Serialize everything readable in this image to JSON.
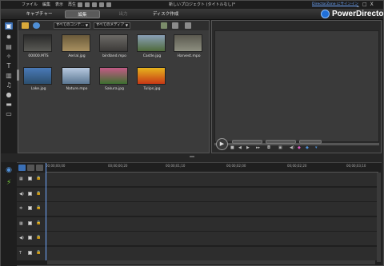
{
  "titlebar": {
    "menu": [
      "ファイル",
      "編集",
      "表示",
      "再生"
    ],
    "title": "新しいプロジェクト (タイトルなし)*",
    "signin": "DirectorZone にサインイン",
    "window_controls": [
      "_",
      "□",
      "X"
    ]
  },
  "modes": {
    "capture": "キャプチャー",
    "edit": "編集",
    "produce": "出力",
    "disc": "ディスク作成"
  },
  "brand": {
    "name": "PowerDirector",
    "logo_color": "#1f6fd8"
  },
  "library": {
    "filter_content": "すべてのコンテ...",
    "filter_media": "すべてのメディア",
    "items": [
      {
        "label": "00000.MTS",
        "icon": "video-thumb",
        "color_top": "#2a2a2a",
        "color_bottom": "#5a5a55"
      },
      {
        "label": "Aerial.jpg",
        "icon": "image-thumb",
        "color_top": "#6a5a3a",
        "color_bottom": "#a89060"
      },
      {
        "label": "birdland.mpo",
        "icon": "image-thumb",
        "color_top": "#6c6a66",
        "color_bottom": "#3c3a38"
      },
      {
        "label": "Castle.jpg",
        "icon": "image-thumb",
        "color_top": "#8aa0b8",
        "color_bottom": "#4f6a3a"
      },
      {
        "label": "Harvest.mpo",
        "icon": "image-thumb",
        "color_top": "#5c5a50",
        "color_bottom": "#8d8f80"
      },
      {
        "label": "Lake.jpg",
        "icon": "image-thumb",
        "color_top": "#4a7ab8",
        "color_bottom": "#2c4f6e"
      },
      {
        "label": "Nature.mpo",
        "icon": "image-thumb",
        "color_top": "#b7c8df",
        "color_bottom": "#5b7792"
      },
      {
        "label": "Sakura.jpg",
        "icon": "image-thumb",
        "color_top": "#c25a86",
        "color_bottom": "#3d6f2f"
      },
      {
        "label": "Tulips.jpg",
        "icon": "image-thumb",
        "color_top": "#e6b41d",
        "color_bottom": "#c83816"
      }
    ]
  },
  "timeline": {
    "ruler_ticks": [
      "00;00;00;00",
      "00;00;00;20",
      "00;00;01;10",
      "00;00;02;00",
      "00;00;02;20",
      "00;00;03;10"
    ],
    "tracks": [
      {
        "icon": "video-track-icon",
        "glyph": "▦"
      },
      {
        "icon": "audio-track-icon",
        "glyph": "◀)"
      },
      {
        "icon": "effect-track-icon",
        "glyph": "✲"
      },
      {
        "icon": "overlay-track-icon",
        "glyph": "▦"
      },
      {
        "icon": "voice-track-icon",
        "glyph": "◀)"
      },
      {
        "icon": "title-track-icon",
        "glyph": "T"
      }
    ]
  }
}
